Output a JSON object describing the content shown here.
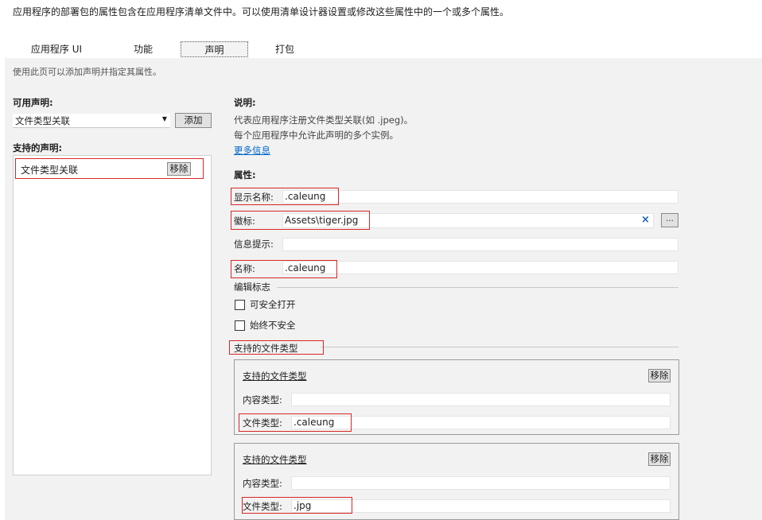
{
  "top_description": "应用程序的部署包的属性包含在应用程序清单文件中。可以使用清单设计器设置或修改这些属性中的一个或多个属性。",
  "tabs": [
    {
      "label": "应用程序 UI"
    },
    {
      "label": "功能"
    },
    {
      "label": "声明"
    },
    {
      "label": "打包"
    }
  ],
  "hint": "使用此页可以添加声明并指定其属性。",
  "available": {
    "label": "可用声明:",
    "selected": "文件类型关联",
    "add_label": "添加"
  },
  "supported": {
    "label": "支持的声明:",
    "items": [
      {
        "label": "文件类型关联",
        "remove_label": "移除"
      }
    ]
  },
  "description": {
    "heading": "说明:",
    "line1": "代表应用程序注册文件类型关联(如 .jpeg)。",
    "line2": "每个应用程序中允许此声明的多个实例。",
    "more_info": "更多信息"
  },
  "properties": {
    "heading": "属性:",
    "display_name_label": "显示名称:",
    "display_name_value": ".caleung",
    "logo_label": "徽标:",
    "logo_value": "Assets\\tiger.jpg",
    "browse_label": "...",
    "clear_icon": "×",
    "tooltip_label": "信息提示:",
    "tooltip_value": "",
    "name_label": "名称:",
    "name_value": ".caleung",
    "edit_flags_label": "编辑标志",
    "open_safe_label": "可安全打开",
    "always_unsafe_label": "始终不安全",
    "supported_types_label": "支持的文件类型"
  },
  "file_types": [
    {
      "title": "支持的文件类型",
      "remove_label": "移除",
      "content_type_label": "内容类型:",
      "content_type_value": "",
      "file_type_label": "文件类型:",
      "file_type_value": ".caleung"
    },
    {
      "title": "支持的文件类型",
      "remove_label": "移除",
      "content_type_label": "内容类型:",
      "content_type_value": "",
      "file_type_label": "文件类型:",
      "file_type_value": ".jpg"
    }
  ],
  "colors": {
    "highlight_red": "#d92626",
    "link_blue": "#0066cc",
    "panel_bg": "#f2f2f2"
  }
}
